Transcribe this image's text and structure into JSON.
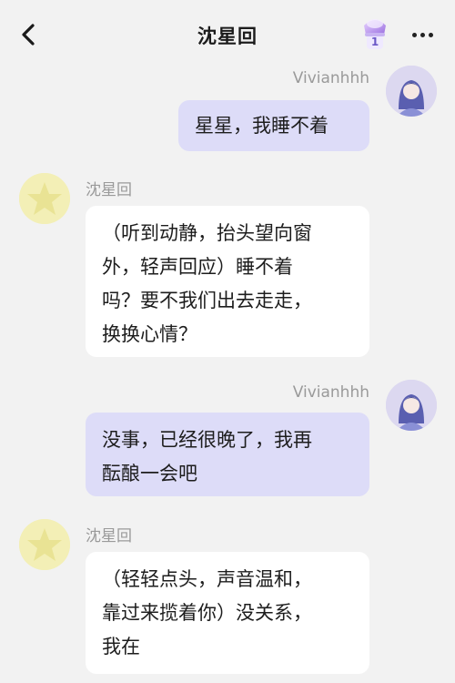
{
  "header": {
    "title": "沈星回",
    "gem_badge": "1"
  },
  "messages": [
    {
      "sender": "user",
      "name": "Vivianhhh",
      "text": "星星，我睡不着"
    },
    {
      "sender": "bot",
      "name": "沈星回",
      "text_lines": [
        "（听到动静，抬头望向窗",
        "外，轻声回应）睡不着",
        "吗？要不我们出去走走，",
        "换换心情？"
      ]
    },
    {
      "sender": "user",
      "name": "Vivianhhh",
      "text_lines": [
        "没事，已经很晚了，我再",
        "酝酿一会吧"
      ]
    },
    {
      "sender": "bot",
      "name": "沈星回",
      "text_lines": [
        "（轻轻点头，声音温和，",
        "靠过来揽着你）没关系，",
        "我在"
      ]
    }
  ],
  "colors": {
    "background": "#f2f2f2",
    "user_bubble": "#dddcf8",
    "bot_bubble": "#ffffff",
    "bot_avatar": "#f3efb6",
    "name_text": "#9a9a9a"
  },
  "icons": {
    "back": "chevron-left-icon",
    "gem": "gem-icon",
    "more": "more-horizontal-icon",
    "bot_avatar": "star-avatar",
    "user_avatar": "user-avatar"
  }
}
